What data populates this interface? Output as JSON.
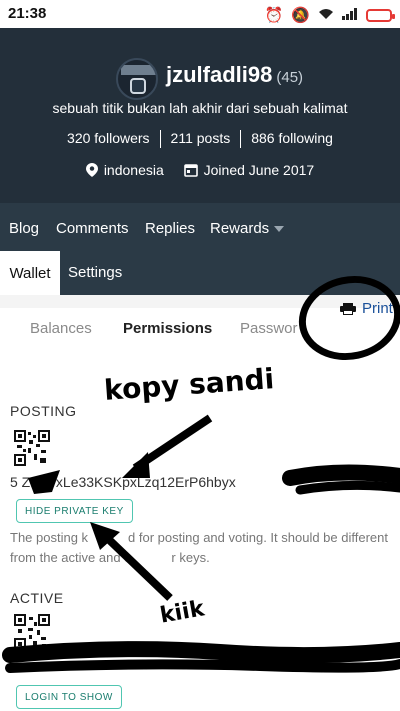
{
  "statusbar": {
    "time": "21:38"
  },
  "profile": {
    "username": "jzulfadli98",
    "reputation": "(45)",
    "bio": "sebuah titik bukan lah akhir dari sebuah kalimat",
    "followers": "320 followers",
    "posts": "211 posts",
    "following": "886 following",
    "location": "indonesia",
    "joined": "Joined June 2017"
  },
  "nav": {
    "blog": "Blog",
    "comments": "Comments",
    "replies": "Replies",
    "rewards": "Rewards"
  },
  "subnav": {
    "wallet": "Wallet",
    "settings": "Settings"
  },
  "wallet": {
    "print": "Print",
    "tabs": {
      "balances": "Balances",
      "permissions": "Permissions",
      "passwords": "Passwor"
    },
    "posting": {
      "label": "POSTING",
      "key": "5 ZLki7xLe33KSKpxLzq12ErP6hbyx",
      "button": "HIDE PRIVATE KEY",
      "description_a": "The posting k",
      "description_b": "d for posting and voting. It should be different",
      "description_c": "from the active and o",
      "description_d": "r keys."
    },
    "active": {
      "label": "ACTIVE",
      "button": "LOGIN TO SHOW"
    }
  },
  "annotations": {
    "kopy_sandi": "kopy sandi",
    "kik": "kiik"
  },
  "colors": {
    "header_bg": "#232f3a",
    "nav_bg": "#2b3a46",
    "accent": "#50c6b1",
    "print_link": "#1a5099"
  }
}
